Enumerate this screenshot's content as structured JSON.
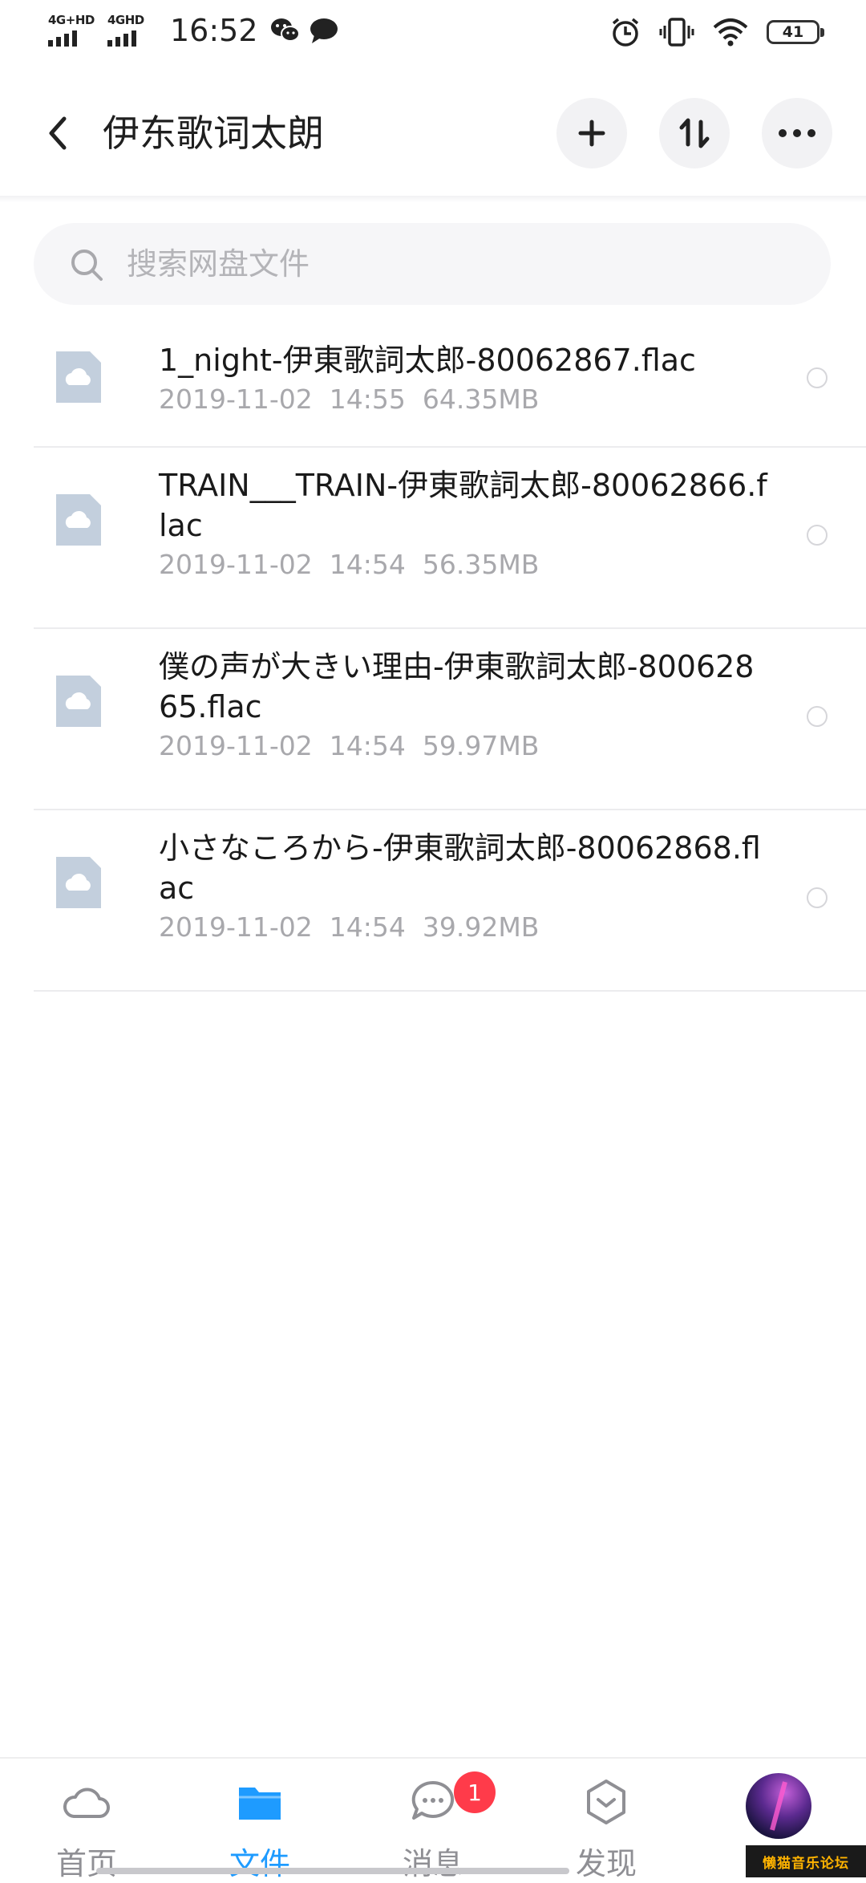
{
  "status_bar": {
    "network_1": "4G+HD",
    "network_2": "4GHD",
    "time": "16:52",
    "battery": "41"
  },
  "header": {
    "title": "伊东歌词太朗",
    "add_icon": "plus-icon",
    "sort_icon": "sort-icon",
    "more_icon": "more-icon"
  },
  "search": {
    "placeholder": "搜索网盘文件"
  },
  "files": [
    {
      "name": "1_night-伊東歌詞太郎-80062867.flac",
      "date": "2019-11-02",
      "time": "14:55",
      "size": "64.35MB"
    },
    {
      "name": "TRAIN___TRAIN-伊東歌詞太郎-80062866.flac",
      "date": "2019-11-02",
      "time": "14:54",
      "size": "56.35MB"
    },
    {
      "name": "僕の声が大きい理由-伊東歌詞太郎-80062865.flac",
      "date": "2019-11-02",
      "time": "14:54",
      "size": "59.97MB"
    },
    {
      "name": "小さなころから-伊東歌詞太郎-80062868.flac",
      "date": "2019-11-02",
      "time": "14:54",
      "size": "39.92MB"
    }
  ],
  "nav": {
    "items": [
      {
        "label": "首页",
        "icon": "cloud-icon"
      },
      {
        "label": "文件",
        "icon": "folder-icon",
        "active": true
      },
      {
        "label": "消息",
        "icon": "chat-icon",
        "badge": "1"
      },
      {
        "label": "发现",
        "icon": "discover-icon"
      },
      {
        "label": "",
        "icon": "avatar"
      }
    ]
  },
  "watermark": "懒猫音乐论坛",
  "colors": {
    "accent": "#1e9bff",
    "badge": "#ff3b4a",
    "file_icon": "#c3cfdd"
  }
}
